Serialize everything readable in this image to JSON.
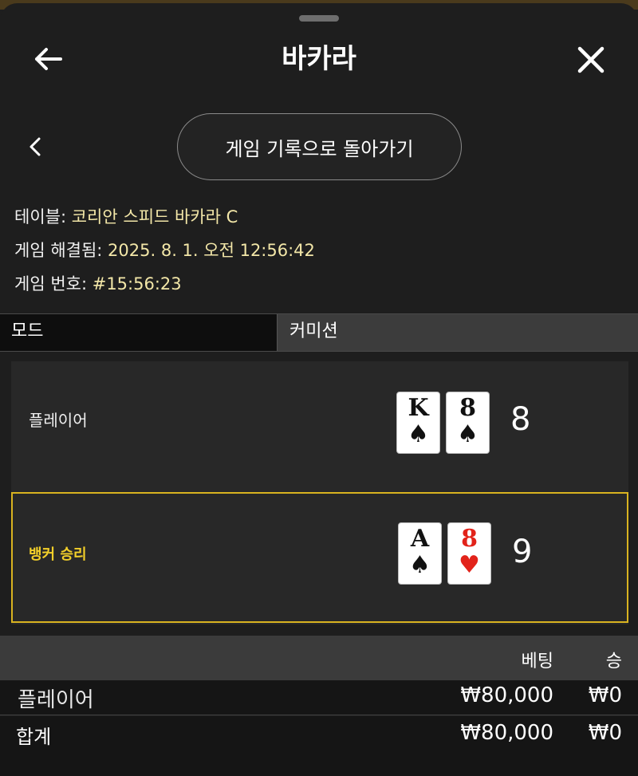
{
  "header": {
    "title": "바카라"
  },
  "nav": {
    "back_to_history_label": "게임 기록으로 돌아가기"
  },
  "info": {
    "table_label": "테이블:",
    "table_value": "코리안 스피드 바카라 C",
    "resolved_label": "게임 해결됨:",
    "resolved_value": "2025. 8. 1. 오전 12:56:42",
    "game_no_label": "게임 번호:",
    "game_no_value": "#15:56:23"
  },
  "mode": {
    "label": "모드",
    "value": "커미션"
  },
  "hands": {
    "player": {
      "label": "플레이어",
      "cards": [
        {
          "rank": "K",
          "suit": "♠",
          "color": "black"
        },
        {
          "rank": "8",
          "suit": "♠",
          "color": "black"
        }
      ],
      "score": "8"
    },
    "banker": {
      "label": "뱅커 승리",
      "cards": [
        {
          "rank": "A",
          "suit": "♠",
          "color": "black"
        },
        {
          "rank": "8",
          "suit": "♥",
          "color": "red"
        }
      ],
      "score": "9"
    }
  },
  "bets": {
    "header_bet": "베팅",
    "header_win": "승",
    "rows": [
      {
        "name": "플레이어",
        "bet": "₩80,000",
        "win": "₩0"
      }
    ],
    "total": {
      "name": "합계",
      "bet": "₩80,000",
      "win": "₩0"
    }
  },
  "colors": {
    "accent_gold": "#d9b320",
    "info_value": "#f3e7a8",
    "card_red": "#e2231a"
  }
}
